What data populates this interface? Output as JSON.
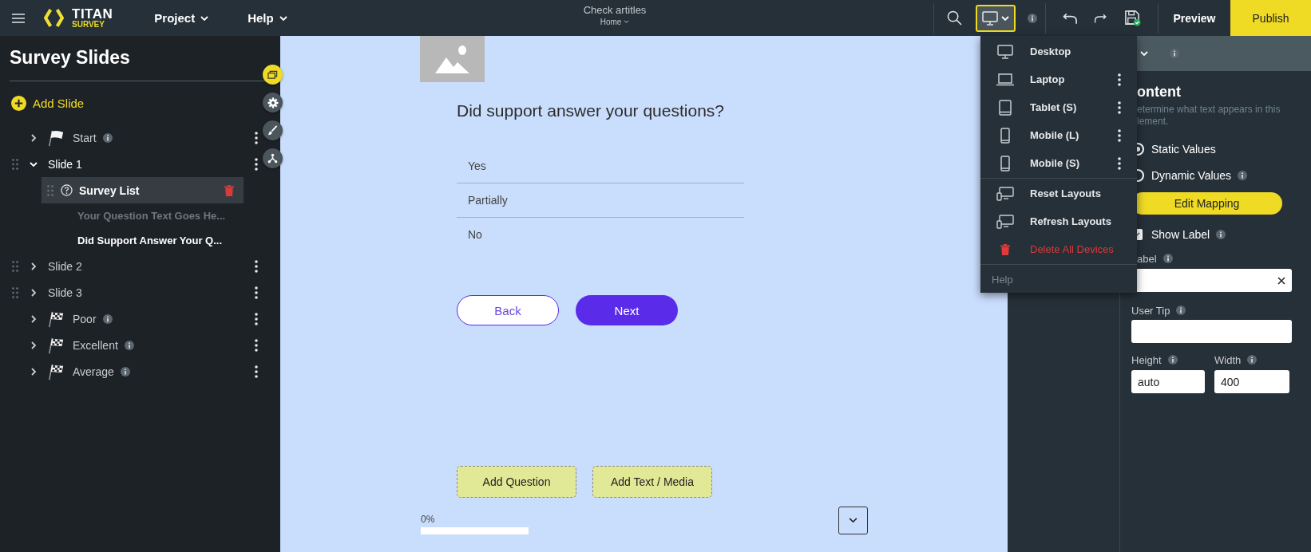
{
  "top_bar": {
    "logo": {
      "title": "TITAN",
      "subtitle": "SURVEY"
    },
    "menus": [
      {
        "label": "Project"
      },
      {
        "label": "Help"
      }
    ],
    "document": {
      "title": "Check artitles",
      "page": "Home"
    },
    "preview": "Preview",
    "publish": "Publish"
  },
  "sidebar": {
    "title": "Survey Slides",
    "add_label": "Add Slide",
    "items": [
      {
        "kind": "start",
        "label": "Start",
        "info": true,
        "expanded": false
      },
      {
        "kind": "slide",
        "label": "Slide 1",
        "info": false,
        "expanded": true,
        "children": [
          {
            "kind": "question",
            "label": "Survey List",
            "selected": true,
            "children": [
              {
                "label": "Your Question Text Goes He...",
                "active": false
              },
              {
                "label": "Did Support Answer Your Q...",
                "active": true
              }
            ]
          }
        ]
      },
      {
        "kind": "slide",
        "label": "Slide 2",
        "info": false,
        "expanded": false
      },
      {
        "kind": "slide",
        "label": "Slide 3",
        "info": false,
        "expanded": false
      },
      {
        "kind": "end",
        "label": "Poor",
        "info": true,
        "expanded": false
      },
      {
        "kind": "end",
        "label": "Excellent",
        "info": true,
        "expanded": false
      },
      {
        "kind": "end",
        "label": "Average",
        "info": true,
        "expanded": false
      }
    ]
  },
  "canvas": {
    "question": "Did support answer your questions?",
    "options": [
      "Yes",
      "Partially",
      "No"
    ],
    "back": "Back",
    "next": "Next",
    "add_buttons": [
      "Add Question",
      "Add Text / Media"
    ],
    "progress": {
      "label": "0%",
      "level": 0
    }
  },
  "device_menu": {
    "expanded": true,
    "items": [
      {
        "kind": "desktop",
        "label": "Desktop",
        "options": false
      },
      {
        "kind": "laptop",
        "label": "Laptop",
        "options": true
      },
      {
        "kind": "tablet",
        "label": "Tablet (S)",
        "options": true
      },
      {
        "kind": "mobile",
        "label": "Mobile (L)",
        "options": true
      },
      {
        "kind": "mobile",
        "label": "Mobile (S)",
        "options": true
      },
      {
        "kind": "layout",
        "label": "Reset Layouts",
        "options": false
      },
      {
        "kind": "layout",
        "label": "Refresh Layouts",
        "options": false
      },
      {
        "kind": "delete",
        "label": "Delete All Devices",
        "options": false
      }
    ],
    "help": "Help"
  },
  "properties": {
    "heading": "ontent",
    "description": [
      "etermine what text appears in this",
      "lement."
    ],
    "values": [
      {
        "label": "Static Values",
        "selected": true,
        "info": false
      },
      {
        "label": "Dynamic Values",
        "selected": false,
        "info": true
      }
    ],
    "edit_button": "Edit Mapping",
    "show_label": {
      "label": "Show Label",
      "checked": true
    },
    "label_field": {
      "label": "abel"
    },
    "tip_field": {
      "label": "User Tip"
    },
    "size_fields": [
      {
        "label": "Height",
        "value": "auto"
      },
      {
        "label": "Width",
        "value": "400"
      }
    ]
  }
}
